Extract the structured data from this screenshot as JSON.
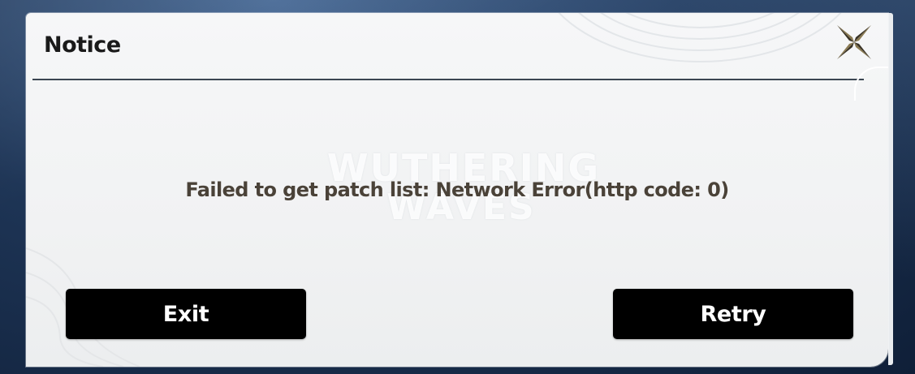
{
  "dialog": {
    "title": "Notice",
    "watermark_line1": "WUTHERING",
    "watermark_line2": "WAVES",
    "message": "Failed to get patch list: Network Error(http code: 0)",
    "close_icon": "close-x-star-icon"
  },
  "buttons": {
    "exit_label": "Exit",
    "retry_label": "Retry"
  },
  "colors": {
    "dialog_bg": "#f4f5f6",
    "title_text": "#1a1a1a",
    "message_text": "#4a4238",
    "button_bg": "#000000",
    "button_text": "#ffffff",
    "close_icon_gold": "#8a7a52",
    "close_icon_dark": "#3a3326",
    "divider": "#3b4652",
    "backdrop": "#1e3556"
  }
}
